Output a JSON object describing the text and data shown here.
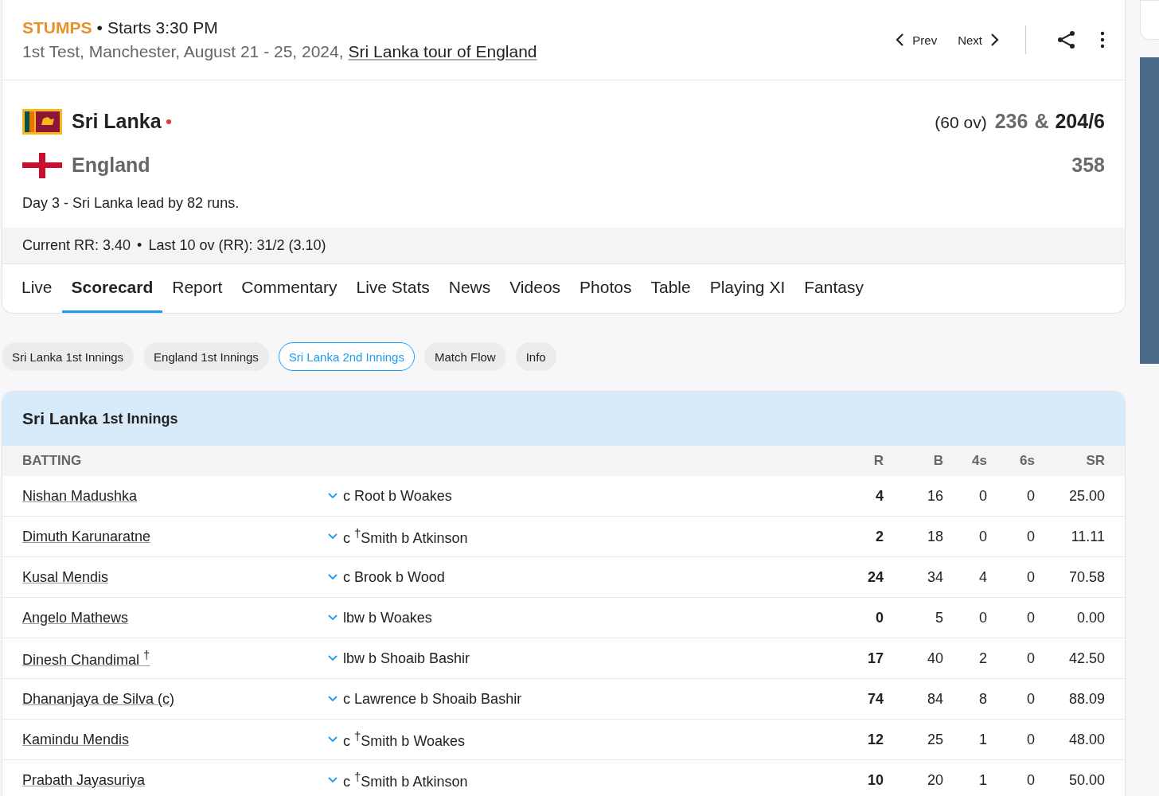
{
  "match": {
    "status": "STUMPS",
    "start": "Starts 3:30 PM",
    "info": "1st Test, Manchester, August 21 - 25, 2024,",
    "series_link": "Sri Lanka tour of England",
    "separator": "•"
  },
  "nav": {
    "prev": "Prev",
    "next": "Next"
  },
  "teams": [
    {
      "name": "Sri Lanka",
      "kind": "sri-lanka",
      "batting": true,
      "overs": "(60 ov)",
      "scores": [
        {
          "text": "236",
          "current": false
        },
        {
          "text": "&",
          "current": false
        },
        {
          "text": "204/6",
          "current": true
        }
      ]
    },
    {
      "name": "England",
      "kind": "england",
      "batting": false,
      "scores": [
        {
          "text": "358",
          "current": false
        }
      ]
    }
  ],
  "result": "Day 3 - Sri Lanka lead by 82 runs.",
  "run_rate": {
    "current": "Current RR: 3.40",
    "last": "Last 10 ov (RR): 31/2 (3.10)",
    "separator": "•"
  },
  "tabs": [
    {
      "label": "Live",
      "selected": false
    },
    {
      "label": "Scorecard",
      "selected": true
    },
    {
      "label": "Report",
      "selected": false
    },
    {
      "label": "Commentary",
      "selected": false
    },
    {
      "label": "Live Stats",
      "selected": false
    },
    {
      "label": "News",
      "selected": false
    },
    {
      "label": "Videos",
      "selected": false
    },
    {
      "label": "Photos",
      "selected": false
    },
    {
      "label": "Table",
      "selected": false
    },
    {
      "label": "Playing XI",
      "selected": false
    },
    {
      "label": "Fantasy",
      "selected": false
    }
  ],
  "innings_pills": [
    {
      "label": "Sri Lanka 1st Innings",
      "selected": false
    },
    {
      "label": "England 1st Innings",
      "selected": false
    },
    {
      "label": "Sri Lanka 2nd Innings",
      "selected": true
    },
    {
      "label": "Match Flow",
      "selected": false
    },
    {
      "label": "Info",
      "selected": false
    }
  ],
  "innings": {
    "team": "Sri Lanka",
    "label": "1st Innings"
  },
  "table": {
    "columns": [
      "BATTING",
      "R",
      "B",
      "4s",
      "6s",
      "SR"
    ],
    "rows": [
      {
        "batter": "Nishan Madushka",
        "dismissal": "c Root b Woakes",
        "r": "4",
        "b": "16",
        "fours": "0",
        "sixes": "0",
        "sr": "25.00"
      },
      {
        "batter": "Dimuth Karunaratne",
        "dismissal": "c $^{†}$Smith b Atkinson",
        "r": "2",
        "b": "18",
        "fours": "0",
        "sixes": "0",
        "sr": "11.11"
      },
      {
        "batter": "Kusal Mendis",
        "dismissal": "c Brook b Wood",
        "r": "24",
        "b": "34",
        "fours": "4",
        "sixes": "0",
        "sr": "70.58"
      },
      {
        "batter": "Angelo Mathews",
        "dismissal": "lbw b Woakes",
        "r": "0",
        "b": "5",
        "fours": "0",
        "sixes": "0",
        "sr": "0.00"
      },
      {
        "batter": "Dinesh Chandimal $^{†}$",
        "dismissal": "lbw b Shoaib Bashir",
        "r": "17",
        "b": "40",
        "fours": "2",
        "sixes": "0",
        "sr": "42.50"
      },
      {
        "batter": "Dhananjaya de Silva (c)",
        "dismissal": "c Lawrence b Shoaib Bashir",
        "r": "74",
        "b": "84",
        "fours": "8",
        "sixes": "0",
        "sr": "88.09"
      },
      {
        "batter": "Kamindu Mendis",
        "dismissal": "c $^{†}$Smith b Woakes",
        "r": "12",
        "b": "25",
        "fours": "1",
        "sixes": "0",
        "sr": "48.00"
      },
      {
        "batter": "Prabath Jayasuriya",
        "dismissal": "c $^{†}$Smith b Atkinson",
        "r": "10",
        "b": "20",
        "fours": "1",
        "sixes": "0",
        "sr": "50.00"
      }
    ]
  }
}
